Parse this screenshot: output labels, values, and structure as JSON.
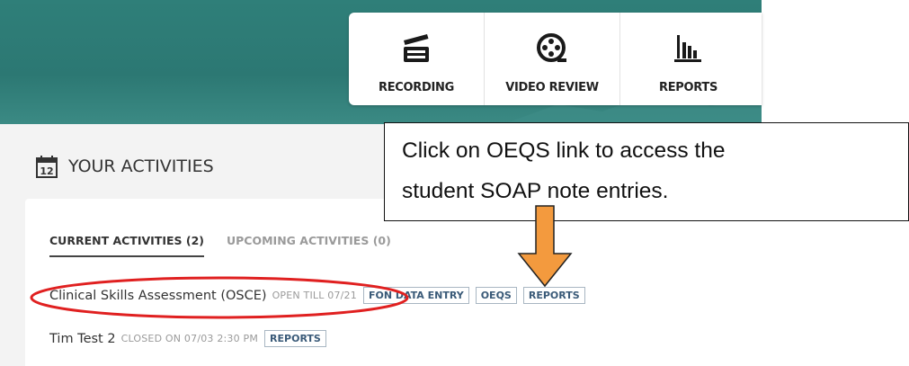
{
  "nav": {
    "tiles": [
      {
        "label": "RECORDING",
        "icon": "clapperboard-icon"
      },
      {
        "label": "VIDEO REVIEW",
        "icon": "film-reel-icon"
      },
      {
        "label": "REPORTS",
        "icon": "bar-chart-icon"
      }
    ]
  },
  "activities": {
    "day_number": "12",
    "title": "YOUR ACTIVITIES",
    "tabs": [
      {
        "label": "CURRENT ACTIVITIES (2)",
        "active": true
      },
      {
        "label": "UPCOMING ACTIVITIES (0)",
        "active": false
      }
    ],
    "rows": [
      {
        "name": "Clinical Skills Assessment (OSCE)",
        "status": "OPEN TILL 07/21",
        "buttons": [
          "FON DATA ENTRY",
          "OEQS",
          "REPORTS"
        ]
      },
      {
        "name": "Tim Test 2",
        "status": "CLOSED ON 07/03 2:30 PM",
        "buttons": [
          "REPORTS"
        ]
      }
    ]
  },
  "annotation": {
    "line1": "Click on OEQS link to access the",
    "line2": "student SOAP note entries.",
    "arrow_color": "#f39a3e",
    "ellipse_color": "#e02020"
  },
  "colors": {
    "banner": "#2c7873",
    "panel": "#f3f3f3",
    "chip_text": "#3a5a78"
  }
}
